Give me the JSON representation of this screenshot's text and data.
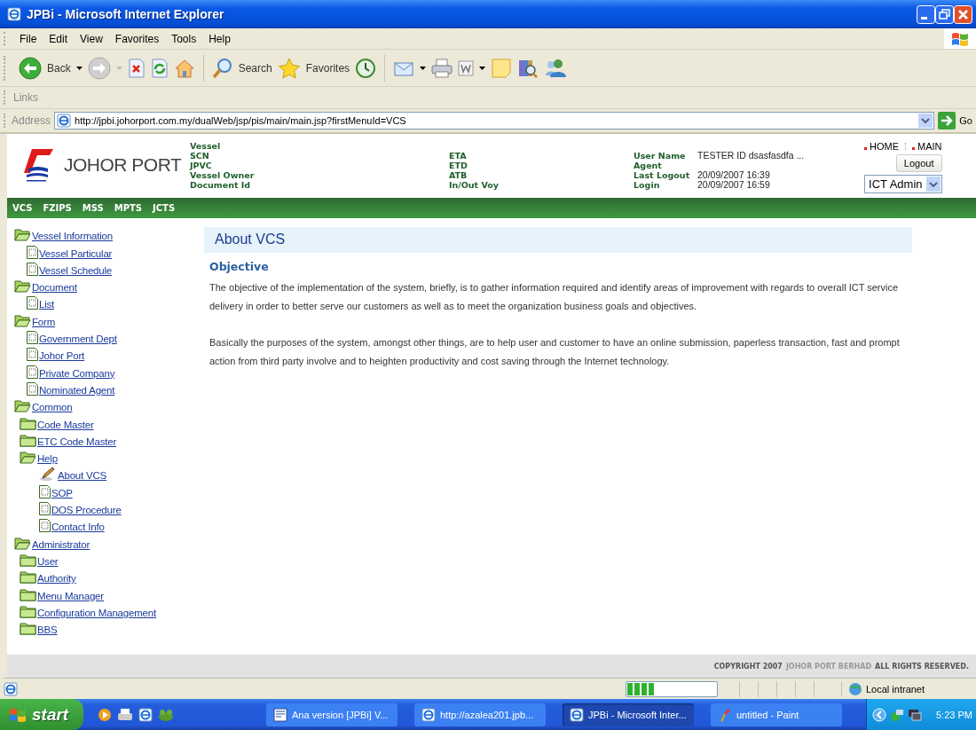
{
  "window": {
    "title": "JPBi - Microsoft Internet Explorer"
  },
  "menu": [
    "File",
    "Edit",
    "View",
    "Favorites",
    "Tools",
    "Help"
  ],
  "toolbar": [
    {
      "kind": "back",
      "label": "Back"
    },
    {
      "kind": "forward"
    },
    {
      "kind": "stop"
    },
    {
      "kind": "refresh"
    },
    {
      "kind": "home"
    },
    {
      "kind": "search",
      "label": "Search"
    },
    {
      "kind": "favorites",
      "label": "Favorites"
    },
    {
      "kind": "history"
    },
    {
      "kind": "mail"
    },
    {
      "kind": "print"
    },
    {
      "kind": "word"
    },
    {
      "kind": "note"
    },
    {
      "kind": "research"
    },
    {
      "kind": "messenger"
    }
  ],
  "links_bar": {
    "label": "Links"
  },
  "address_bar": {
    "label": "Address",
    "value": "http://jpbi.johorport.com.my/dualWeb/jsp/pis/main/main.jsp?firstMenuId=VCS",
    "go": "Go"
  },
  "header": {
    "brand": "JOHOR PORT",
    "fields_1": [
      "Vessel",
      "SCN",
      "JPVC",
      "Vessel Owner",
      "Document Id"
    ],
    "fields_2": [
      "ETA",
      "ETD",
      "ATB",
      "In/Out Voy"
    ],
    "user": [
      {
        "label": "User Name",
        "value": "TESTER ID dsasfasdfa ..."
      },
      {
        "label": "Agent"
      },
      {
        "label": "Last Logout",
        "value": "20/09/2007 16:39"
      },
      {
        "label": "Login",
        "value": "20/09/2007 16:59"
      }
    ],
    "links": [
      "HOME",
      "MAIN"
    ],
    "logout": "Logout",
    "role": "ICT Admin"
  },
  "nav": [
    "VCS",
    "FZIPS",
    "MSS",
    "MPTS",
    "JCTS"
  ],
  "tree": [
    {
      "label": "Vessel Information",
      "kind": "folder",
      "expanded": true,
      "children": [
        {
          "label": "Vessel Particular",
          "kind": "page"
        },
        {
          "label": "Vessel Schedule",
          "kind": "page"
        }
      ]
    },
    {
      "label": "Document",
      "kind": "folder",
      "expanded": true,
      "children": [
        {
          "label": "List",
          "kind": "page"
        }
      ]
    },
    {
      "label": "Form",
      "kind": "folder",
      "expanded": true,
      "children": [
        {
          "label": "Government Dept",
          "kind": "page"
        },
        {
          "label": "Johor Port",
          "kind": "page"
        },
        {
          "label": "Private Company",
          "kind": "page"
        },
        {
          "label": "Nominated Agent",
          "kind": "page"
        }
      ]
    },
    {
      "label": "Common",
      "kind": "folder",
      "expanded": true,
      "children": [
        {
          "label": "Code Master",
          "kind": "folder",
          "expanded": false
        },
        {
          "label": "ETC Code Master",
          "kind": "folder",
          "expanded": false
        },
        {
          "label": "Help",
          "kind": "folder",
          "expanded": true,
          "children": [
            {
              "label": "About VCS",
              "kind": "current"
            },
            {
              "label": "SOP",
              "kind": "page"
            },
            {
              "label": "DOS Procedure",
              "kind": "page"
            },
            {
              "label": "Contact Info",
              "kind": "page"
            }
          ]
        }
      ]
    },
    {
      "label": "Administrator",
      "kind": "folder",
      "expanded": true,
      "children": [
        {
          "label": "User",
          "kind": "folder",
          "expanded": false
        },
        {
          "label": "Authority",
          "kind": "folder",
          "expanded": false
        },
        {
          "label": "Menu Manager",
          "kind": "folder",
          "expanded": false
        },
        {
          "label": "Configuration Management",
          "kind": "folder",
          "expanded": false
        },
        {
          "label": "BBS",
          "kind": "folder",
          "expanded": false
        }
      ]
    }
  ],
  "content": {
    "title": "About VCS",
    "heading": "Objective",
    "paragraphs": [
      "The objective of the implementation of the system, briefly, is to gather information required and identify areas of improvement with regards to overall ICT service delivery in order to better serve our customers as well as to meet the organization business goals and objectives.",
      "Basically the purposes of the system, amongst other things, are to help user and customer to have an online submission, paperless transaction, fast and prompt action from third party involve and to heighten productivity and cost saving through the Internet technology."
    ]
  },
  "footer": {
    "copyright": [
      "COPYRIGHT 2007",
      "JOHOR PORT BERHAD",
      "ALL RIGHTS RESERVED."
    ]
  },
  "status_bar": {
    "progress": {
      "level": 0.3
    },
    "zone": "Local intranet"
  },
  "taskbar": {
    "start": "start",
    "tasks": [
      {
        "label": "Ana version [JPBi] V...",
        "kind": "word",
        "selected": false
      },
      {
        "label": "http://azalea201.jpb...",
        "kind": "browser",
        "selected": false
      },
      {
        "label": "JPBi - Microsoft Inter...",
        "kind": "browser",
        "selected": true
      },
      {
        "label": "untitled - Paint",
        "kind": "paint",
        "selected": false
      }
    ],
    "clock": "5:23 PM"
  }
}
